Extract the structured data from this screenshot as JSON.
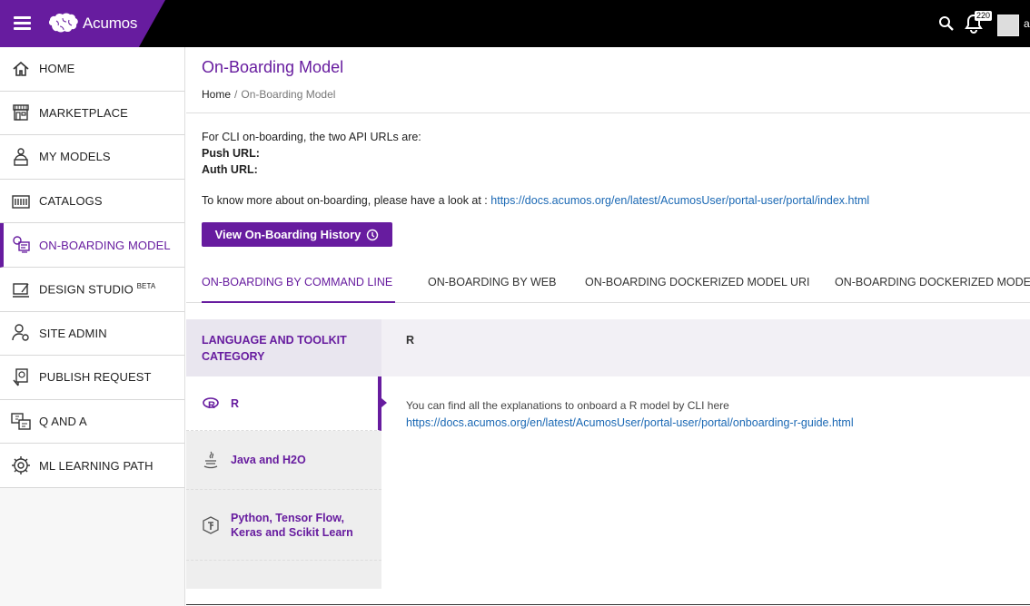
{
  "header": {
    "brand_name": "Acumos",
    "notification_count": "220",
    "user_initial": "a"
  },
  "sidebar": {
    "items": [
      {
        "label": "HOME",
        "icon": "home-icon"
      },
      {
        "label": "MARKETPLACE",
        "icon": "store-icon"
      },
      {
        "label": "MY MODELS",
        "icon": "user-models-icon"
      },
      {
        "label": "CATALOGS",
        "icon": "catalog-icon"
      },
      {
        "label": "ON-BOARDING MODEL",
        "icon": "onboarding-icon"
      },
      {
        "label": "DESIGN STUDIO",
        "sup": "BETA",
        "icon": "design-icon"
      },
      {
        "label": "SITE ADMIN",
        "icon": "admin-icon"
      },
      {
        "label": "PUBLISH REQUEST",
        "icon": "publish-icon"
      },
      {
        "label": "Q AND A",
        "icon": "qa-icon"
      },
      {
        "label": "ML LEARNING PATH",
        "icon": "brain-gear-icon"
      }
    ],
    "active_index": 4
  },
  "page": {
    "title": "On-Boarding Model",
    "breadcrumb": [
      "Home",
      "/",
      "On-Boarding Model"
    ],
    "intro": "For CLI on-boarding, the two API URLs are:",
    "push_label": "Push URL:",
    "auth_label": "Auth URL:",
    "more_text": "To know more about on-boarding, please have a look at :",
    "more_link": "https://docs.acumos.org/en/latest/AcumosUser/portal-user/portal/index.html",
    "history_button": "View On-Boarding History"
  },
  "tabs": [
    "ON-BOARDING BY COMMAND LINE",
    "ON-BOARDING BY WEB",
    "ON-BOARDING DOCKERIZED MODEL URI",
    "ON-BOARDING DOCKERIZED MODEL"
  ],
  "category": {
    "heading": "LANGUAGE AND TOOLKIT CATEGORY",
    "items": [
      "R",
      "Java and H2O",
      "Python, Tensor Flow, Keras and Scikit Learn"
    ],
    "selected": "R"
  },
  "content": {
    "heading": "R",
    "text": "You can find all the explanations to onboard a R model by CLI here",
    "link": "https://docs.acumos.org/en/latest/AcumosUser/portal-user/portal/onboarding-r-guide.html"
  },
  "colors": {
    "accent": "#671c9f",
    "link": "#1a68b4",
    "topbar": "#000000"
  }
}
